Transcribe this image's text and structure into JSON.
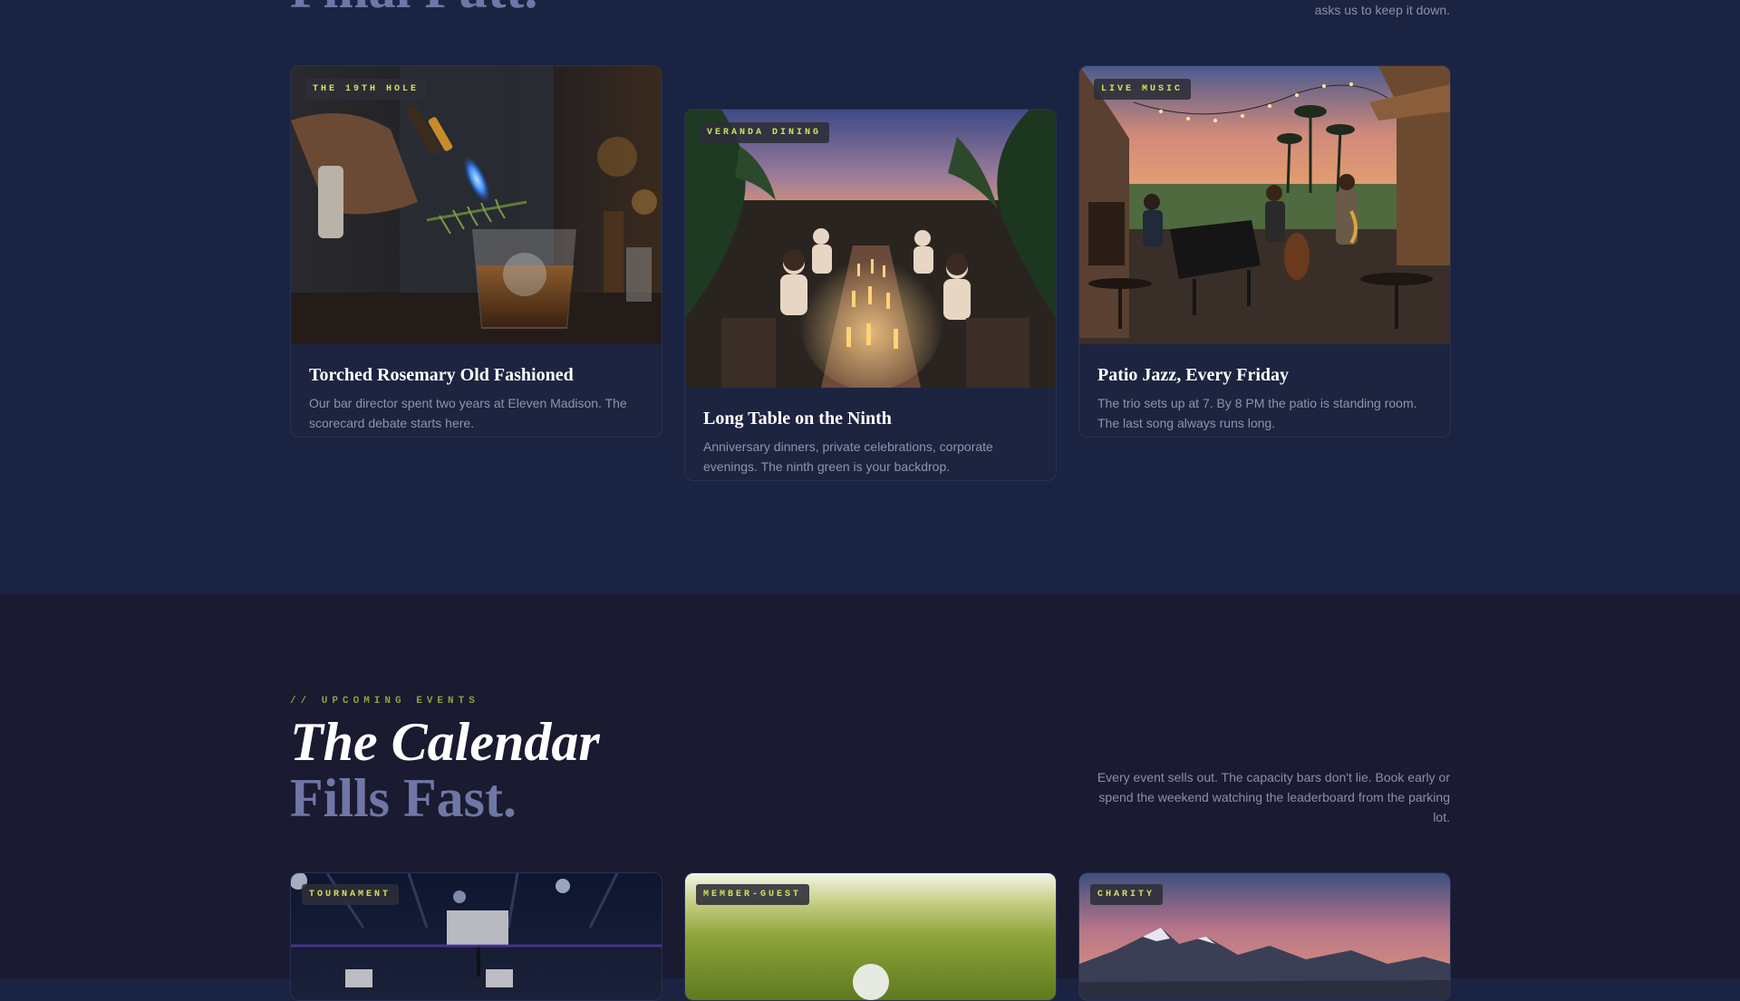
{
  "intro": {
    "title_fragment": "Final Putt.",
    "desc_fragment": "asks us to keep it down."
  },
  "cards": [
    {
      "badge": "THE 19TH HOLE",
      "title": "Torched Rosemary Old Fashioned",
      "text": "Our bar director spent two years at Eleven Madison. The scorecard debate starts here."
    },
    {
      "badge": "VERANDA DINING",
      "title": "Long Table on the Ninth",
      "text": "Anniversary dinners, private celebrations, corporate evenings. The ninth green is your backdrop."
    },
    {
      "badge": "LIVE MUSIC",
      "title": "Patio Jazz, Every Friday",
      "text": "The trio sets up at 7. By 8 PM the patio is standing room. The last song always runs long."
    }
  ],
  "events": {
    "eyebrow": "// UPCOMING EVENTS",
    "title_line1": "The Calendar",
    "title_line2": "Fills Fast.",
    "description": "Every event sells out. The capacity bars don't lie. Book early or spend the weekend watching the leaderboard from the parking lot.",
    "cards": [
      {
        "badge": "TOURNAMENT"
      },
      {
        "badge": "MEMBER-GUEST"
      },
      {
        "badge": "CHARITY"
      }
    ]
  },
  "colors": {
    "section_top_bg": "#1a2342",
    "section_bottom_bg": "#1a1a30",
    "badge_text": "#cfe35a",
    "accent_title": "#6f77a6"
  }
}
